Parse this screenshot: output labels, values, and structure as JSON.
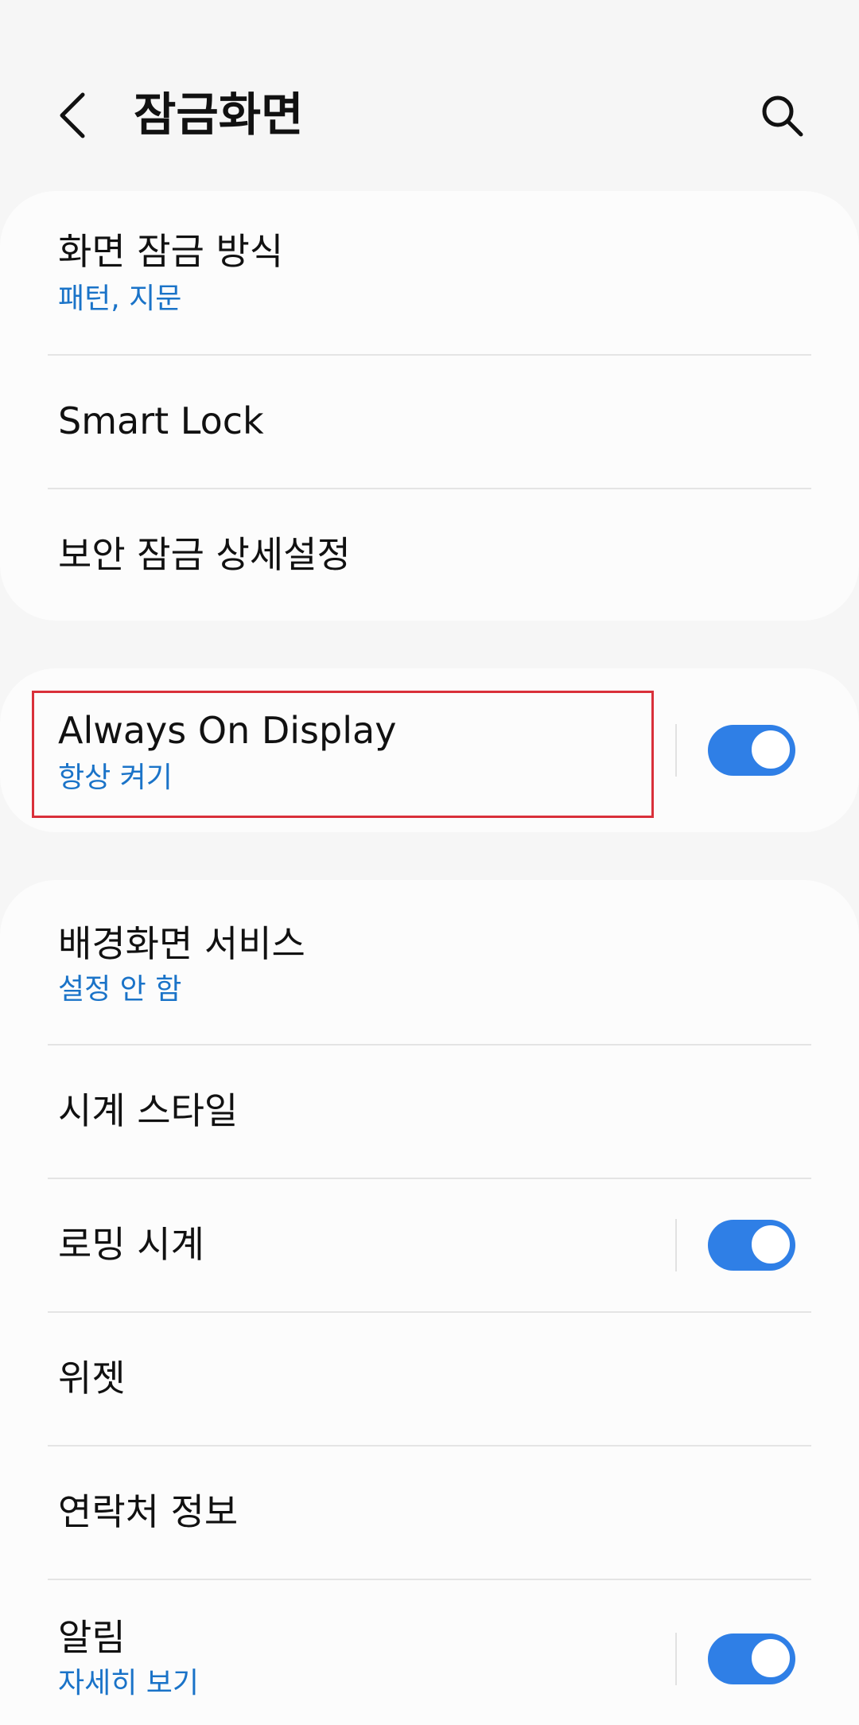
{
  "header": {
    "title": "잠금화면",
    "back_icon": "chevron-left-icon",
    "search_icon": "search-icon"
  },
  "lock_card": {
    "items": [
      {
        "title": "화면 잠금 방식",
        "subtitle": "패턴, 지문"
      },
      {
        "title": "Smart Lock"
      },
      {
        "title": "보안 잠금 상세설정"
      }
    ]
  },
  "aod_card": {
    "title": "Always On Display",
    "subtitle": "항상 켜기",
    "toggle_on": true
  },
  "more_card": {
    "items": [
      {
        "title": "배경화면 서비스",
        "subtitle": "설정 안 함"
      },
      {
        "title": "시계 스타일"
      },
      {
        "title": "로밍 시계",
        "toggle_on": true
      },
      {
        "title": "위젯"
      },
      {
        "title": "연락처 정보"
      },
      {
        "title": "알림",
        "subtitle": "자세히 보기",
        "toggle_on": true
      }
    ]
  },
  "colors": {
    "accent": "#1a73c8",
    "toggle": "#2f7fe6",
    "highlight": "#d9303a",
    "background": "#f6f6f6",
    "card": "#fcfcfc"
  }
}
